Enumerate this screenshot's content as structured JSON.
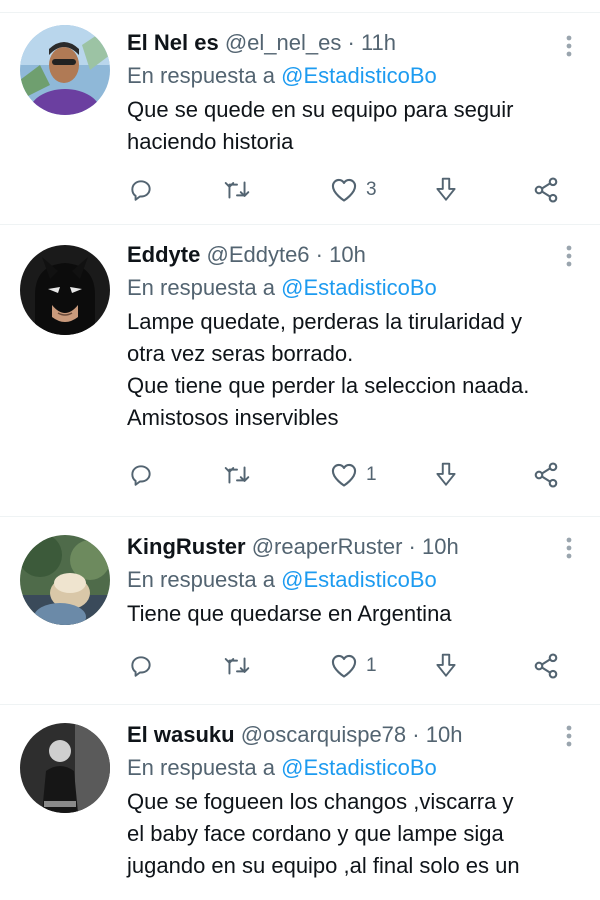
{
  "tweets": [
    {
      "name": "El Nel es",
      "handle": "@el_nel_es",
      "dot": "·",
      "time": "11h",
      "reply_prefix": "En respuesta a",
      "reply_handle": "@EstadisticoBo",
      "lines": [
        "Que se quede en su equipo para seguir",
        "haciendo historia"
      ],
      "likes": "3"
    },
    {
      "name": "Eddyte",
      "handle": "@Eddyte6",
      "dot": "·",
      "time": "10h",
      "reply_prefix": "En respuesta a",
      "reply_handle": "@EstadisticoBo",
      "lines": [
        "Lampe quedate, perderas la tirularidad y",
        "otra vez seras borrado.",
        "Que tiene que perder la seleccion naada.",
        "Amistosos inservibles"
      ],
      "likes": "1"
    },
    {
      "name": "KingRuster",
      "handle": "@reaperRuster",
      "dot": "·",
      "time": "10h",
      "reply_prefix": "En respuesta a",
      "reply_handle": "@EstadisticoBo",
      "lines": [
        "Tiene que quedarse en Argentina"
      ],
      "likes": "1"
    },
    {
      "name": "El wasuku",
      "handle": "@oscarquispe78",
      "dot": "·",
      "time": "10h",
      "reply_prefix": "En respuesta a",
      "reply_handle": "@EstadisticoBo",
      "lines": [
        "Que se fogueen los changos ,viscarra y",
        "el baby face cordano y que lampe siga",
        "jugando en su equipo ,al final solo es un"
      ],
      "likes": ""
    }
  ],
  "icons": {
    "reply": "reply-icon",
    "retweet": "retweet-icon",
    "like": "heart-icon",
    "bookmark": "bookmark-icon",
    "share": "share-icon",
    "more": "more-options-icon"
  },
  "colors": {
    "text": "#0f1419",
    "muted": "#536471",
    "link": "#1d9bf0",
    "divider": "#eff3f4"
  }
}
